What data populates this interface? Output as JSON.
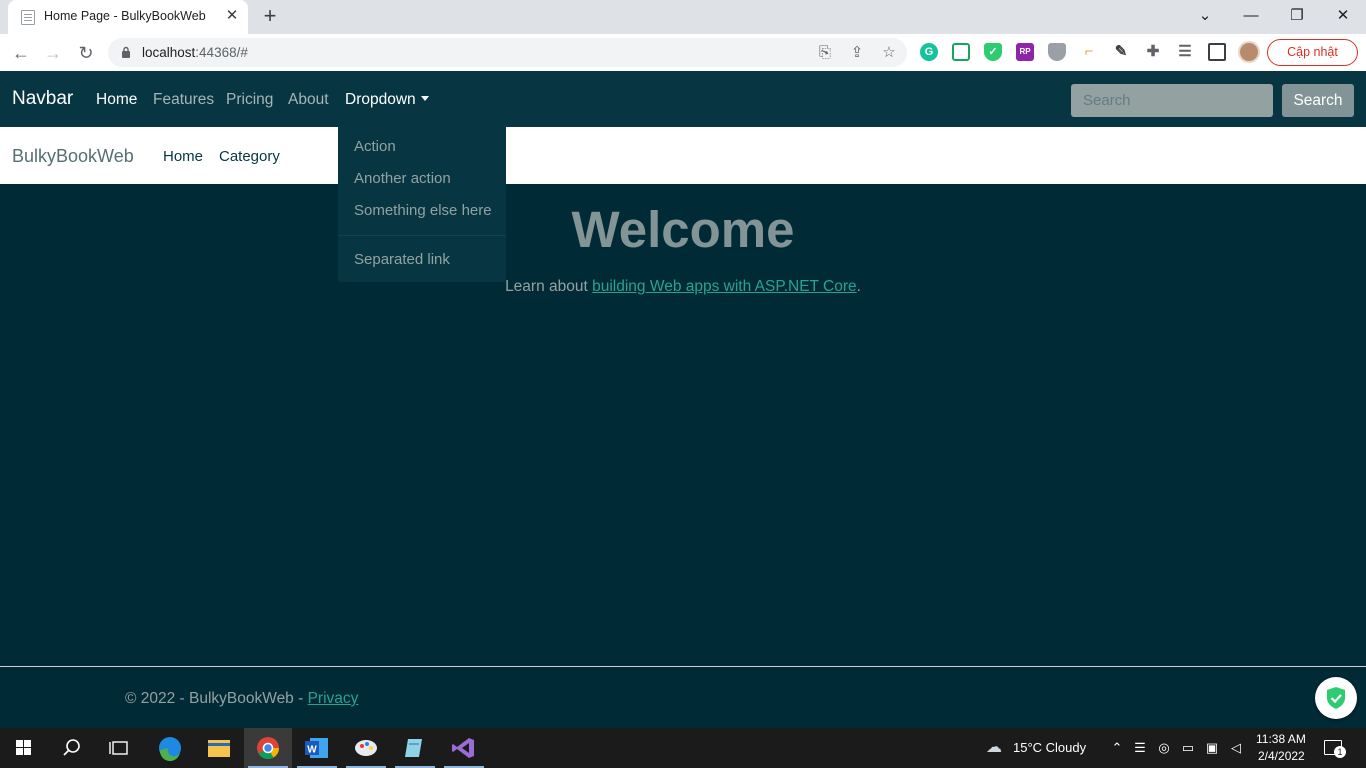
{
  "browser": {
    "tab_title": "Home Page - BulkyBookWeb",
    "tab_close": "✕",
    "new_tab": "+",
    "window_controls": {
      "menu": "⌄",
      "minimize": "—",
      "restore": "❐",
      "close": "✕"
    },
    "back": "←",
    "forward": "→",
    "reload": "↻",
    "url_host": "localhost",
    "url_rest": ":44368/#",
    "update_label": "Cập nhật",
    "extensions": [
      "grammarly-icon",
      "screenshot-icon",
      "shield-check-icon",
      "rp-icon",
      "hexagon-shield-icon",
      "ruler-icon",
      "eyedropper-icon",
      "puzzle-icon",
      "playlist-icon",
      "sidebar-icon"
    ]
  },
  "topnav": {
    "brand": "Navbar",
    "links": [
      "Home",
      "Features",
      "Pricing",
      "About"
    ],
    "dropdown": "Dropdown",
    "search_placeholder": "Search",
    "search_button": "Search"
  },
  "subnav": {
    "brand": "BulkyBookWeb",
    "links": [
      "Home",
      "Category"
    ]
  },
  "dropdown_menu": {
    "items": [
      "Action",
      "Another action",
      "Something else here"
    ],
    "separated": "Separated link"
  },
  "main": {
    "heading": "Welcome",
    "learn_prefix": "Learn about ",
    "learn_link": "building Web apps with ASP.NET Core",
    "learn_suffix": "."
  },
  "footer": {
    "text": "© 2022 - BulkyBookWeb - ",
    "privacy": "Privacy"
  },
  "taskbar": {
    "weather": "15°C  Cloudy",
    "time": "11:38 AM",
    "date": "2/4/2022",
    "notification_count": "1"
  },
  "colors": {
    "page_bg": "#002b36",
    "navbar_bg": "#073642",
    "link": "#2aa198",
    "muted_text": "#93a1a1"
  }
}
